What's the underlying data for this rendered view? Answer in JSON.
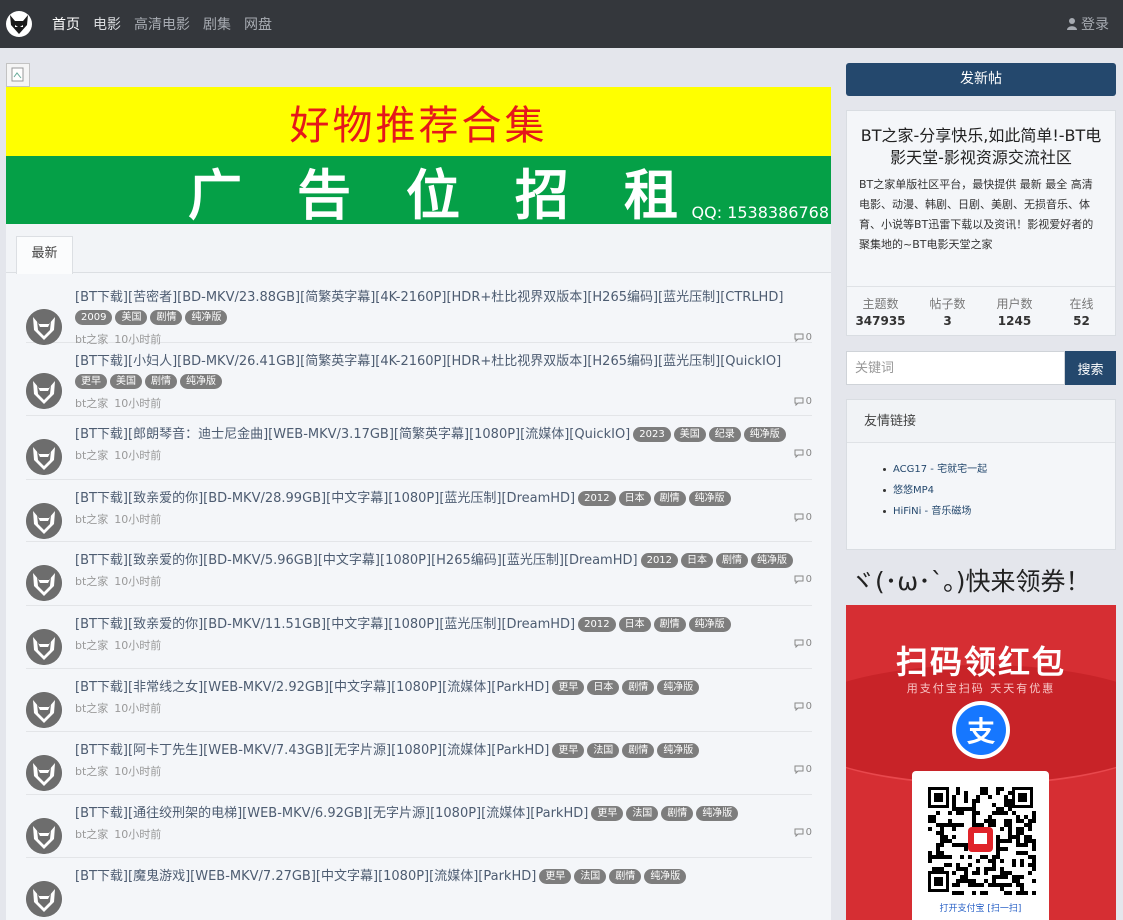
{
  "nav": {
    "items": [
      "首页",
      "电影",
      "高清电影",
      "剧集",
      "网盘"
    ],
    "login_label": "登录"
  },
  "banner": {
    "headline": "好物推荐合集",
    "ad_chars": [
      "广",
      "告",
      "位",
      "招",
      "租"
    ],
    "qq": "QQ: 1538386768"
  },
  "tabs": {
    "latest": "最新"
  },
  "threads": [
    {
      "title": "[BT下载][苦密者][BD-MKV/23.88GB][简繁英字幕][4K-2160P][HDR+杜比视界双版本][H265编码][蓝光压制][CTRLHD]",
      "tags_inline": [],
      "tags_below": [
        "2009",
        "美国",
        "剧情",
        "纯净版"
      ],
      "author": "bt之家",
      "time": "10小时前",
      "replies": "0"
    },
    {
      "title": "[BT下载][小妇人][BD-MKV/26.41GB][简繁英字幕][4K-2160P][HDR+杜比视界双版本][H265编码][蓝光压制][QuickIO]",
      "tags_inline": [],
      "tags_below": [
        "更早",
        "美国",
        "剧情",
        "纯净版"
      ],
      "author": "bt之家",
      "time": "10小时前",
      "replies": "0"
    },
    {
      "title": "[BT下载][郎朗琴音：迪士尼金曲][WEB-MKV/3.17GB][简繁英字幕][1080P][流媒体][QuickIO]",
      "tags_inline": [
        "2023",
        "美国",
        "纪录",
        "纯净版"
      ],
      "tags_below": [],
      "author": "bt之家",
      "time": "10小时前",
      "replies": "0"
    },
    {
      "title": "[BT下载][致亲爱的你][BD-MKV/28.99GB][中文字幕][1080P][蓝光压制][DreamHD]",
      "tags_inline": [
        "2012",
        "日本",
        "剧情",
        "纯净版"
      ],
      "tags_below": [],
      "author": "bt之家",
      "time": "10小时前",
      "replies": "0"
    },
    {
      "title": "[BT下载][致亲爱的你][BD-MKV/5.96GB][中文字幕][1080P][H265编码][蓝光压制][DreamHD]",
      "tags_inline": [
        "2012",
        "日本",
        "剧情",
        "纯净版"
      ],
      "tags_below": [],
      "author": "bt之家",
      "time": "10小时前",
      "replies": "0"
    },
    {
      "title": "[BT下载][致亲爱的你][BD-MKV/11.51GB][中文字幕][1080P][蓝光压制][DreamHD]",
      "tags_inline": [
        "2012",
        "日本",
        "剧情",
        "纯净版"
      ],
      "tags_below": [],
      "author": "bt之家",
      "time": "10小时前",
      "replies": "0"
    },
    {
      "title": "[BT下载][非常线之女][WEB-MKV/2.92GB][中文字幕][1080P][流媒体][ParkHD]",
      "tags_inline": [
        "更早",
        "日本",
        "剧情",
        "纯净版"
      ],
      "tags_below": [],
      "author": "bt之家",
      "time": "10小时前",
      "replies": "0"
    },
    {
      "title": "[BT下载][阿卡丁先生][WEB-MKV/7.43GB][无字片源][1080P][流媒体][ParkHD]",
      "tags_inline": [
        "更早",
        "法国",
        "剧情",
        "纯净版"
      ],
      "tags_below": [],
      "author": "bt之家",
      "time": "10小时前",
      "replies": "0"
    },
    {
      "title": "[BT下载][通往绞刑架的电梯][WEB-MKV/6.92GB][无字片源][1080P][流媒体][ParkHD]",
      "tags_inline": [
        "更早",
        "法国",
        "剧情",
        "纯净版"
      ],
      "tags_below": [],
      "author": "bt之家",
      "time": "10小时前",
      "replies": "0"
    },
    {
      "title": "[BT下载][魔鬼游戏][WEB-MKV/7.27GB][中文字幕][1080P][流媒体][ParkHD]",
      "tags_inline": [
        "更早",
        "法国",
        "剧情",
        "纯净版"
      ],
      "tags_below": [],
      "author": "",
      "time": "",
      "replies": ""
    }
  ],
  "sidebar": {
    "post_button": "发新帖",
    "site_title": "BT之家-分享快乐,如此简单!-BT电影天堂-影视资源交流社区",
    "site_desc": "BT之家单版社区平台，最快提供 最新 最全 高清 电影、动漫、韩剧、日剧、美剧、无损音乐、体育、小说等BT迅雷下载以及资讯！影视爱好者的聚集地的~BT电影天堂之家",
    "stats": [
      {
        "label": "主题数",
        "value": "347935"
      },
      {
        "label": "帖子数",
        "value": "3"
      },
      {
        "label": "用户数",
        "value": "1245"
      },
      {
        "label": "在线",
        "value": "52"
      }
    ],
    "search_placeholder": "关键词",
    "search_button": "搜索",
    "links_title": "友情链接",
    "links": [
      "ACG17 - 宅就宅一起",
      "悠悠MP4",
      "HiFiNi - 音乐磁场"
    ],
    "promo_title": "ヾ(･ω･`｡)快来领券！",
    "redpack_title": "扫码领红包",
    "redpack_sub": "用支付宝扫码 天天有优惠",
    "alipay_char": "支",
    "scan_label": "打开支付宝 [扫一扫]"
  },
  "icons": {
    "logo": "fox-logo-icon",
    "avatar": "fox-avatar-icon",
    "user": "user-icon",
    "reply": "comment-icon",
    "broken_image": "broken-image-icon"
  },
  "colors": {
    "topbar": "#34373c",
    "accent": "#24486d",
    "banner_yellow": "#ffff00",
    "banner_green": "#05a047",
    "tag": "#7d7d7d",
    "redpack": "#d62e33"
  }
}
